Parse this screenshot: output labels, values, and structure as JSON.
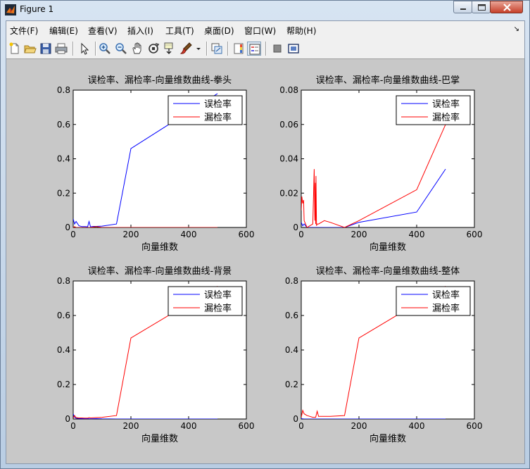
{
  "window": {
    "title": "Figure 1"
  },
  "menubar": {
    "items": [
      {
        "label": "文件(F)"
      },
      {
        "label": "编辑(E)"
      },
      {
        "label": "查看(V)"
      },
      {
        "label": "插入(I)"
      },
      {
        "label": "工具(T)"
      },
      {
        "label": "桌面(D)"
      },
      {
        "label": "窗口(W)"
      },
      {
        "label": "帮助(H)"
      }
    ],
    "overflow_arrow": "↘"
  },
  "toolbar": {
    "icons": [
      "new-figure-icon",
      "open-file-icon",
      "save-icon",
      "print-icon",
      "edit-plot-arrow-icon",
      "zoom-in-icon",
      "zoom-out-icon",
      "pan-hand-icon",
      "rotate-3d-icon",
      "data-cursor-icon",
      "brush-icon",
      "brush-dropdown-icon",
      "link-plot-icon",
      "colorbar-icon",
      "legend-icon",
      "hide-plot-tools-icon",
      "show-plot-tools-icon"
    ]
  },
  "chart_data": [
    {
      "type": "line",
      "title": "误检率、漏检率-向量维数曲线-拳头",
      "xlabel": "向量维数",
      "ylabel": "",
      "xlim": [
        0,
        600
      ],
      "ylim": [
        0,
        0.8
      ],
      "xticks": [
        "0",
        "200",
        "400",
        "600"
      ],
      "yticks": [
        "0",
        "0.2",
        "0.4",
        "0.6",
        "0.8"
      ],
      "legend_position": "top-right",
      "series": [
        {
          "name": "误检率",
          "color": "#0000ff",
          "x": [
            0,
            5,
            10,
            20,
            30,
            40,
            50,
            55,
            60,
            70,
            80,
            100,
            150,
            200,
            500
          ],
          "y": [
            0.05,
            0.02,
            0.035,
            0.01,
            0.005,
            0.005,
            0.004,
            0.035,
            0.004,
            0.006,
            0.006,
            0.008,
            0.02,
            0.46,
            0.78
          ]
        },
        {
          "name": "漏检率",
          "color": "#ff0000",
          "x": [
            0,
            5,
            10,
            20,
            40,
            60,
            80,
            100,
            150,
            200,
            400,
            500
          ],
          "y": [
            0.0,
            0.005,
            0.0,
            0.0,
            0.0,
            0.0,
            0.005,
            0.0,
            0.0,
            0.0,
            0.0,
            0.0
          ]
        }
      ]
    },
    {
      "type": "line",
      "title": "误检率、漏检率-向量维数曲线-巴掌",
      "xlabel": "向量维数",
      "ylabel": "",
      "xlim": [
        0,
        600
      ],
      "ylim": [
        0,
        0.08
      ],
      "xticks": [
        "0",
        "200",
        "400",
        "600"
      ],
      "yticks": [
        "0",
        "0.02",
        "0.04",
        "0.06",
        "0.08"
      ],
      "legend_position": "top-right",
      "series": [
        {
          "name": "误检率",
          "color": "#0000ff",
          "x": [
            0,
            5,
            10,
            20,
            30,
            40,
            50,
            60,
            100,
            150,
            200,
            400,
            500
          ],
          "y": [
            0.003,
            0.001,
            0.002,
            0.0,
            0.0,
            0.0,
            0.0,
            0.0,
            0.0,
            0.0,
            0.003,
            0.009,
            0.034
          ]
        },
        {
          "name": "漏检率",
          "color": "#ff0000",
          "x": [
            0,
            2,
            5,
            8,
            10,
            20,
            40,
            45,
            47,
            49,
            50,
            51,
            53,
            55,
            60,
            80,
            100,
            150,
            200,
            400,
            500
          ],
          "y": [
            0.01,
            0.018,
            0.014,
            0.016,
            0.004,
            0.0,
            0.002,
            0.034,
            0.004,
            0.026,
            0.002,
            0.03,
            0.001,
            0.002,
            0.002,
            0.004,
            0.003,
            0.0,
            0.004,
            0.022,
            0.06
          ]
        }
      ]
    },
    {
      "type": "line",
      "title": "误检率、漏检率-向量维数曲线-背景",
      "xlabel": "向量维数",
      "ylabel": "",
      "xlim": [
        0,
        600
      ],
      "ylim": [
        0,
        0.8
      ],
      "xticks": [
        "0",
        "200",
        "400",
        "600"
      ],
      "yticks": [
        "0",
        "0.2",
        "0.4",
        "0.6",
        "0.8"
      ],
      "legend_position": "top-right",
      "series": [
        {
          "name": "误检率",
          "color": "#0000ff",
          "x": [
            0,
            5,
            10,
            20,
            30,
            50,
            60,
            80,
            100,
            150,
            200,
            400,
            500
          ],
          "y": [
            0.03,
            0.01,
            0.005,
            0.003,
            0.002,
            0.002,
            0.001,
            0.002,
            0.001,
            0.0,
            0.0,
            0.0,
            0.0
          ]
        },
        {
          "name": "漏检率",
          "color": "#ff0000",
          "x": [
            0,
            5,
            10,
            20,
            30,
            40,
            50,
            55,
            60,
            80,
            100,
            150,
            200,
            500
          ],
          "y": [
            0.005,
            0.02,
            0.008,
            0.006,
            0.006,
            0.005,
            0.005,
            0.008,
            0.006,
            0.008,
            0.01,
            0.02,
            0.47,
            0.77
          ]
        }
      ]
    },
    {
      "type": "line",
      "title": "误检率、漏检率-向量维数曲线-整体",
      "xlabel": "向量维数",
      "ylabel": "",
      "xlim": [
        0,
        600
      ],
      "ylim": [
        0,
        0.8
      ],
      "xticks": [
        "0",
        "200",
        "400",
        "600"
      ],
      "yticks": [
        "0",
        "0.2",
        "0.4",
        "0.6",
        "0.8"
      ],
      "legend_position": "top-right",
      "series": [
        {
          "name": "误检率",
          "color": "#0000ff",
          "x": [
            0,
            5,
            10,
            20,
            40,
            60,
            100,
            150,
            200,
            400,
            500
          ],
          "y": [
            0.002,
            0.001,
            0.0,
            0.0,
            0.0,
            0.0,
            0.0,
            0.0,
            0.0,
            0.0,
            0.0
          ]
        },
        {
          "name": "漏检率",
          "color": "#ff0000",
          "x": [
            0,
            5,
            10,
            20,
            30,
            40,
            50,
            55,
            60,
            80,
            100,
            150,
            200,
            500
          ],
          "y": [
            0.01,
            0.05,
            0.03,
            0.02,
            0.015,
            0.01,
            0.01,
            0.045,
            0.015,
            0.015,
            0.015,
            0.02,
            0.47,
            0.77
          ]
        }
      ]
    }
  ]
}
